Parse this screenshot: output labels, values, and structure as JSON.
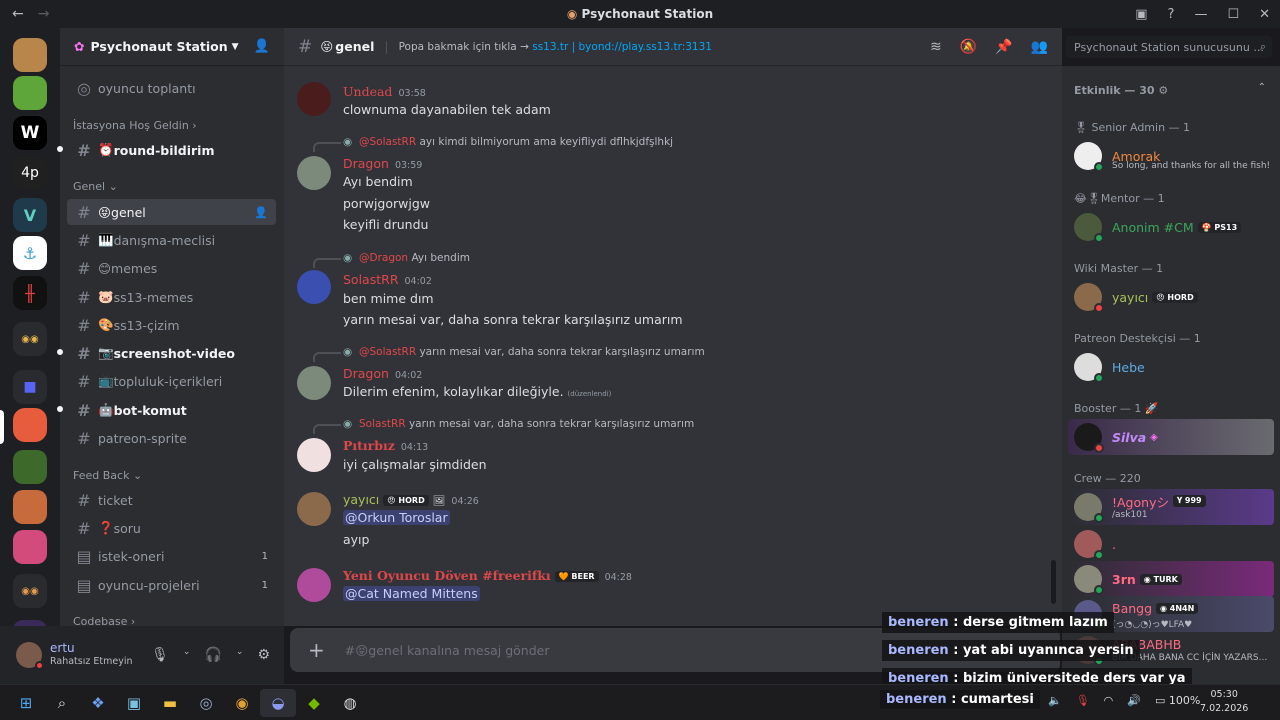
{
  "window": {
    "title": "Psychonaut Station"
  },
  "server": {
    "name": "Psychonaut Station",
    "server_icons": [
      "",
      "",
      "W",
      "4p",
      "V",
      "",
      "",
      "",
      "",
      "",
      "",
      "",
      "",
      "",
      ""
    ]
  },
  "channels": {
    "top": {
      "label": "oyuncu toplantı"
    },
    "cat1": "İstasyona Hoş Geldin",
    "cat2": "Genel",
    "cat3": "Feed Back",
    "cat4": "Codebase",
    "items": [
      {
        "label": "round-bildirim",
        "icon": "⏰"
      },
      {
        "label": "genel",
        "icon": "😝"
      },
      {
        "label": "danışma-meclisi",
        "icon": "🎹"
      },
      {
        "label": "memes",
        "icon": "😊"
      },
      {
        "label": "ss13-memes",
        "icon": "🐷"
      },
      {
        "label": "ss13-çizim",
        "icon": "🎨"
      },
      {
        "label": "screenshot-video",
        "icon": "📷"
      },
      {
        "label": "topluluk-içerikleri",
        "icon": "📺"
      },
      {
        "label": "bot-komut",
        "icon": "🤖"
      },
      {
        "label": "patreon-sprite",
        "icon": ""
      },
      {
        "label": "ticket",
        "icon": ""
      },
      {
        "label": "soru",
        "icon": "❓"
      },
      {
        "label": "istek-oneri",
        "icon": "",
        "badge": "1"
      },
      {
        "label": "oyuncu-projeleri",
        "icon": "",
        "badge": "1"
      }
    ]
  },
  "user": {
    "name": "ertu",
    "status": "Rahatsız Etmeyin"
  },
  "header": {
    "channel": "genel",
    "channel_icon": "😝",
    "topic_prefix": "Popa bakmak için tıkla →",
    "topic_link1": "ss13.tr",
    "topic_sep": " | ",
    "topic_link2": "byond://play.ss13.tr:3131",
    "search_placeholder": "Psychonaut Station sunucusunu ..."
  },
  "messages": [
    {
      "user": "Undead",
      "time": "03:58",
      "lines": [
        "clownuma dayanabilen tek adam"
      ]
    },
    {
      "reply_to": "@SolastRR",
      "reply_text": "ayı kimdi bilmiyorum ama keyifliydi dflhkjdfşlhkj",
      "user": "Dragon",
      "time": "03:59",
      "lines": [
        "Ayı bendim",
        "porwjgorwjgw",
        "keyifli drundu"
      ]
    },
    {
      "reply_to": "@Dragon",
      "reply_text": "Ayı bendim",
      "user": "SolastRR",
      "time": "04:02",
      "lines": [
        "ben mime dım",
        "yarın mesai var, daha sonra tekrar karşılaşırız umarım"
      ]
    },
    {
      "reply_to": "@SolastRR",
      "reply_text": "yarın mesai var, daha sonra tekrar karşılaşırız umarım",
      "user": "Dragon",
      "time": "04:02",
      "lines": [
        "Dilerim efenim, kolaylıkar dileğiyle."
      ],
      "edited": "(düzenlendi)"
    },
    {
      "reply_to": "SolastRR",
      "reply_text": "yarın mesai var, daha sonra tekrar karşılaşırız umarım",
      "user": "Pıtırbız",
      "time": "04:13",
      "lines": [
        "iyi çalışmalar şimdiden"
      ]
    },
    {
      "user": "yayıcı",
      "tag": "HORD",
      "time": "04:26",
      "mention": "@Orkun Toroslar",
      "lines": [
        "ayıp"
      ]
    },
    {
      "user": "Yeni Oyuncu Döven #freerifkı",
      "tag": "BEER",
      "time": "04:28",
      "mention": "@Cat Named Mittens",
      "lines": []
    }
  ],
  "input": {
    "placeholder": "#😝genel kanalına mesaj gönder"
  },
  "members": {
    "header": "Etkinlik — 30",
    "roles": [
      {
        "title": "Senior Admin — 1",
        "members": [
          {
            "name": "Amorak",
            "sub": "So long, and thanks for all the fish!",
            "color": "#f0883e"
          }
        ]
      },
      {
        "title": "Mentor — 1",
        "members": [
          {
            "name": "Anonim #CM",
            "tag": "PS13",
            "color": "#3ba55c"
          }
        ]
      },
      {
        "title": "Wiki Master — 1",
        "members": [
          {
            "name": "yayıcı",
            "tag": "HORD",
            "color": "#a8c256"
          }
        ]
      },
      {
        "title": "Patreon Destekçisi — 1",
        "members": [
          {
            "name": "Hebe",
            "color": "#5dade2"
          }
        ]
      },
      {
        "title": "Booster — 1",
        "members": [
          {
            "name": "Silva",
            "color": "#c58af9"
          }
        ]
      },
      {
        "title": "Crew — 220",
        "members": [
          {
            "name": "!Agonyシ",
            "tag": "999",
            "sub": "/ask101",
            "color": "#ff6b81"
          },
          {
            "name": ".",
            "color": "#ff6b81"
          },
          {
            "name": "3rn",
            "tag": "TURK",
            "color": "#ff6b81"
          },
          {
            "name": "Bangg",
            "tag": "4N4N",
            "sub": "(っ◔◡◔)っ♥LFA♥",
            "color": "#ff6b81"
          },
          {
            "name": "ABABABHB",
            "sub": "BIR DAHA BANA CC İÇİN YAZARS...",
            "color": "#ff6b81"
          }
        ]
      }
    ]
  },
  "overlay": {
    "user": "beneren",
    "sep": " : ",
    "lines": [
      "derse gitmem lazım",
      "yat abi uyanınca yersin",
      "bizim üniversitede ders var ya",
      "cumartesi"
    ]
  },
  "taskbar": {
    "time": "05:30",
    "date": "7.02.2026",
    "battery": "100%"
  }
}
